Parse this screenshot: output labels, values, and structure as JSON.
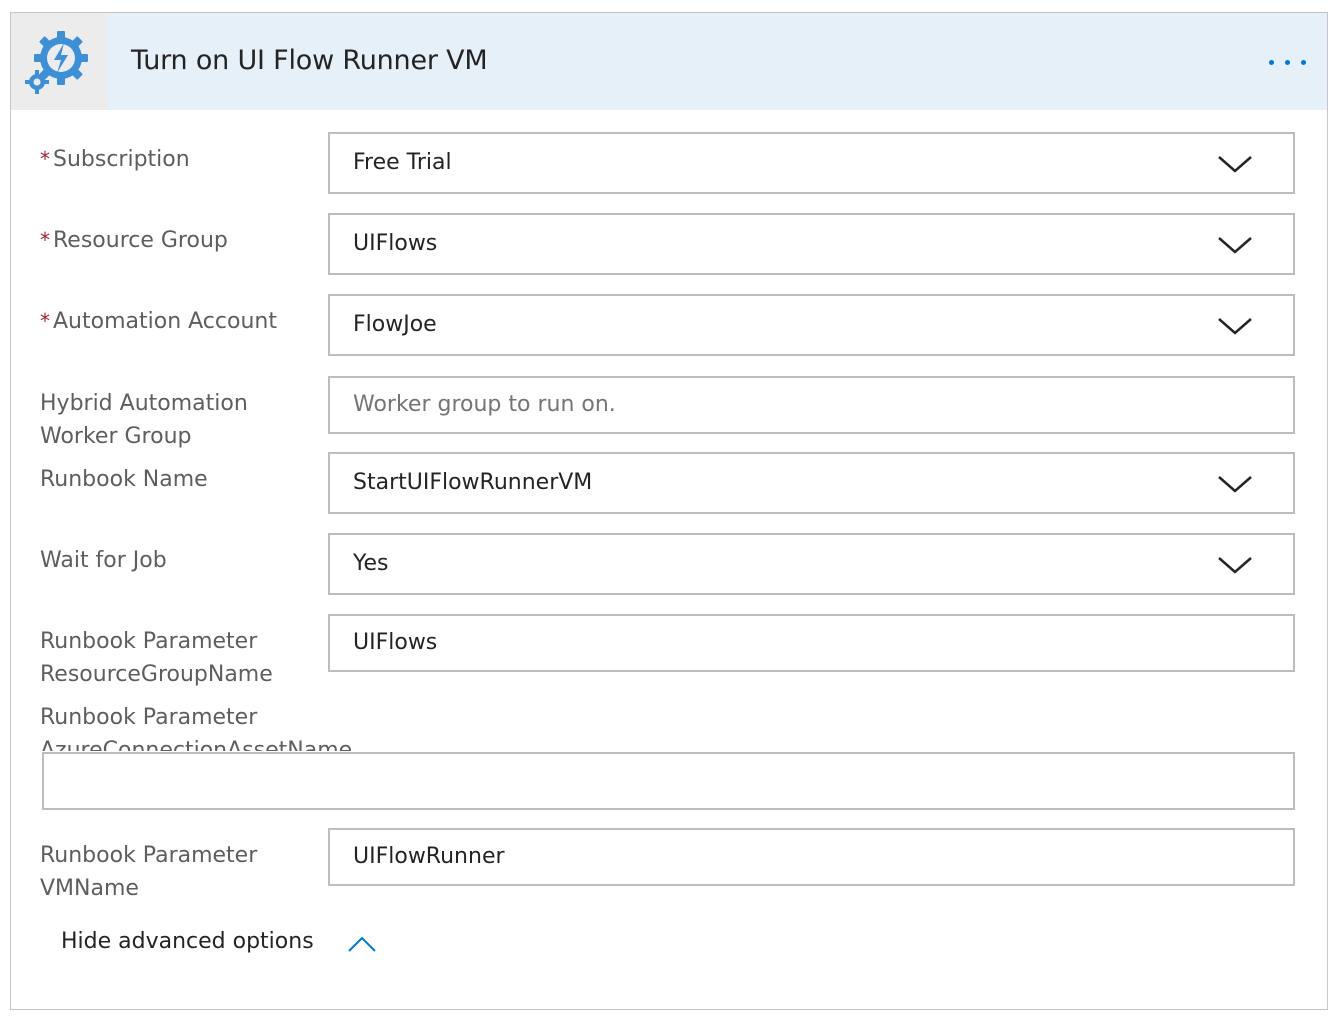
{
  "header": {
    "title": "Turn on UI Flow Runner VM",
    "icon": "gear-lightning-icon",
    "more_icon": "ellipsis-icon",
    "accent": "#0078d4"
  },
  "fields": {
    "subscription": {
      "label": "Subscription",
      "required": true,
      "value": "Free Trial"
    },
    "resource_group": {
      "label": "Resource Group",
      "required": true,
      "value": "UIFlows"
    },
    "automation_account": {
      "label": "Automation Account",
      "required": true,
      "value": "FlowJoe"
    },
    "hybrid_worker": {
      "label_line1": "Hybrid Automation",
      "label_line2": "Worker Group",
      "placeholder": "Worker group to run on."
    },
    "runbook_name": {
      "label": "Runbook Name",
      "value": "StartUIFlowRunnerVM"
    },
    "wait_for_job": {
      "label": "Wait for Job",
      "value": "Yes"
    },
    "param_rg": {
      "label_line1": "Runbook Parameter",
      "label_line2": "ResourceGroupName",
      "value": "UIFlows"
    },
    "param_conn": {
      "label_line1": "Runbook Parameter",
      "label_line2": "AzureConnectionAssetName",
      "value": ""
    },
    "param_vm": {
      "label_line1": "Runbook Parameter",
      "label_line2": "VMName",
      "value": "UIFlowRunner"
    }
  },
  "required_marker": "*",
  "advanced": {
    "label": "Hide advanced options",
    "icon": "chevron-up-icon"
  }
}
